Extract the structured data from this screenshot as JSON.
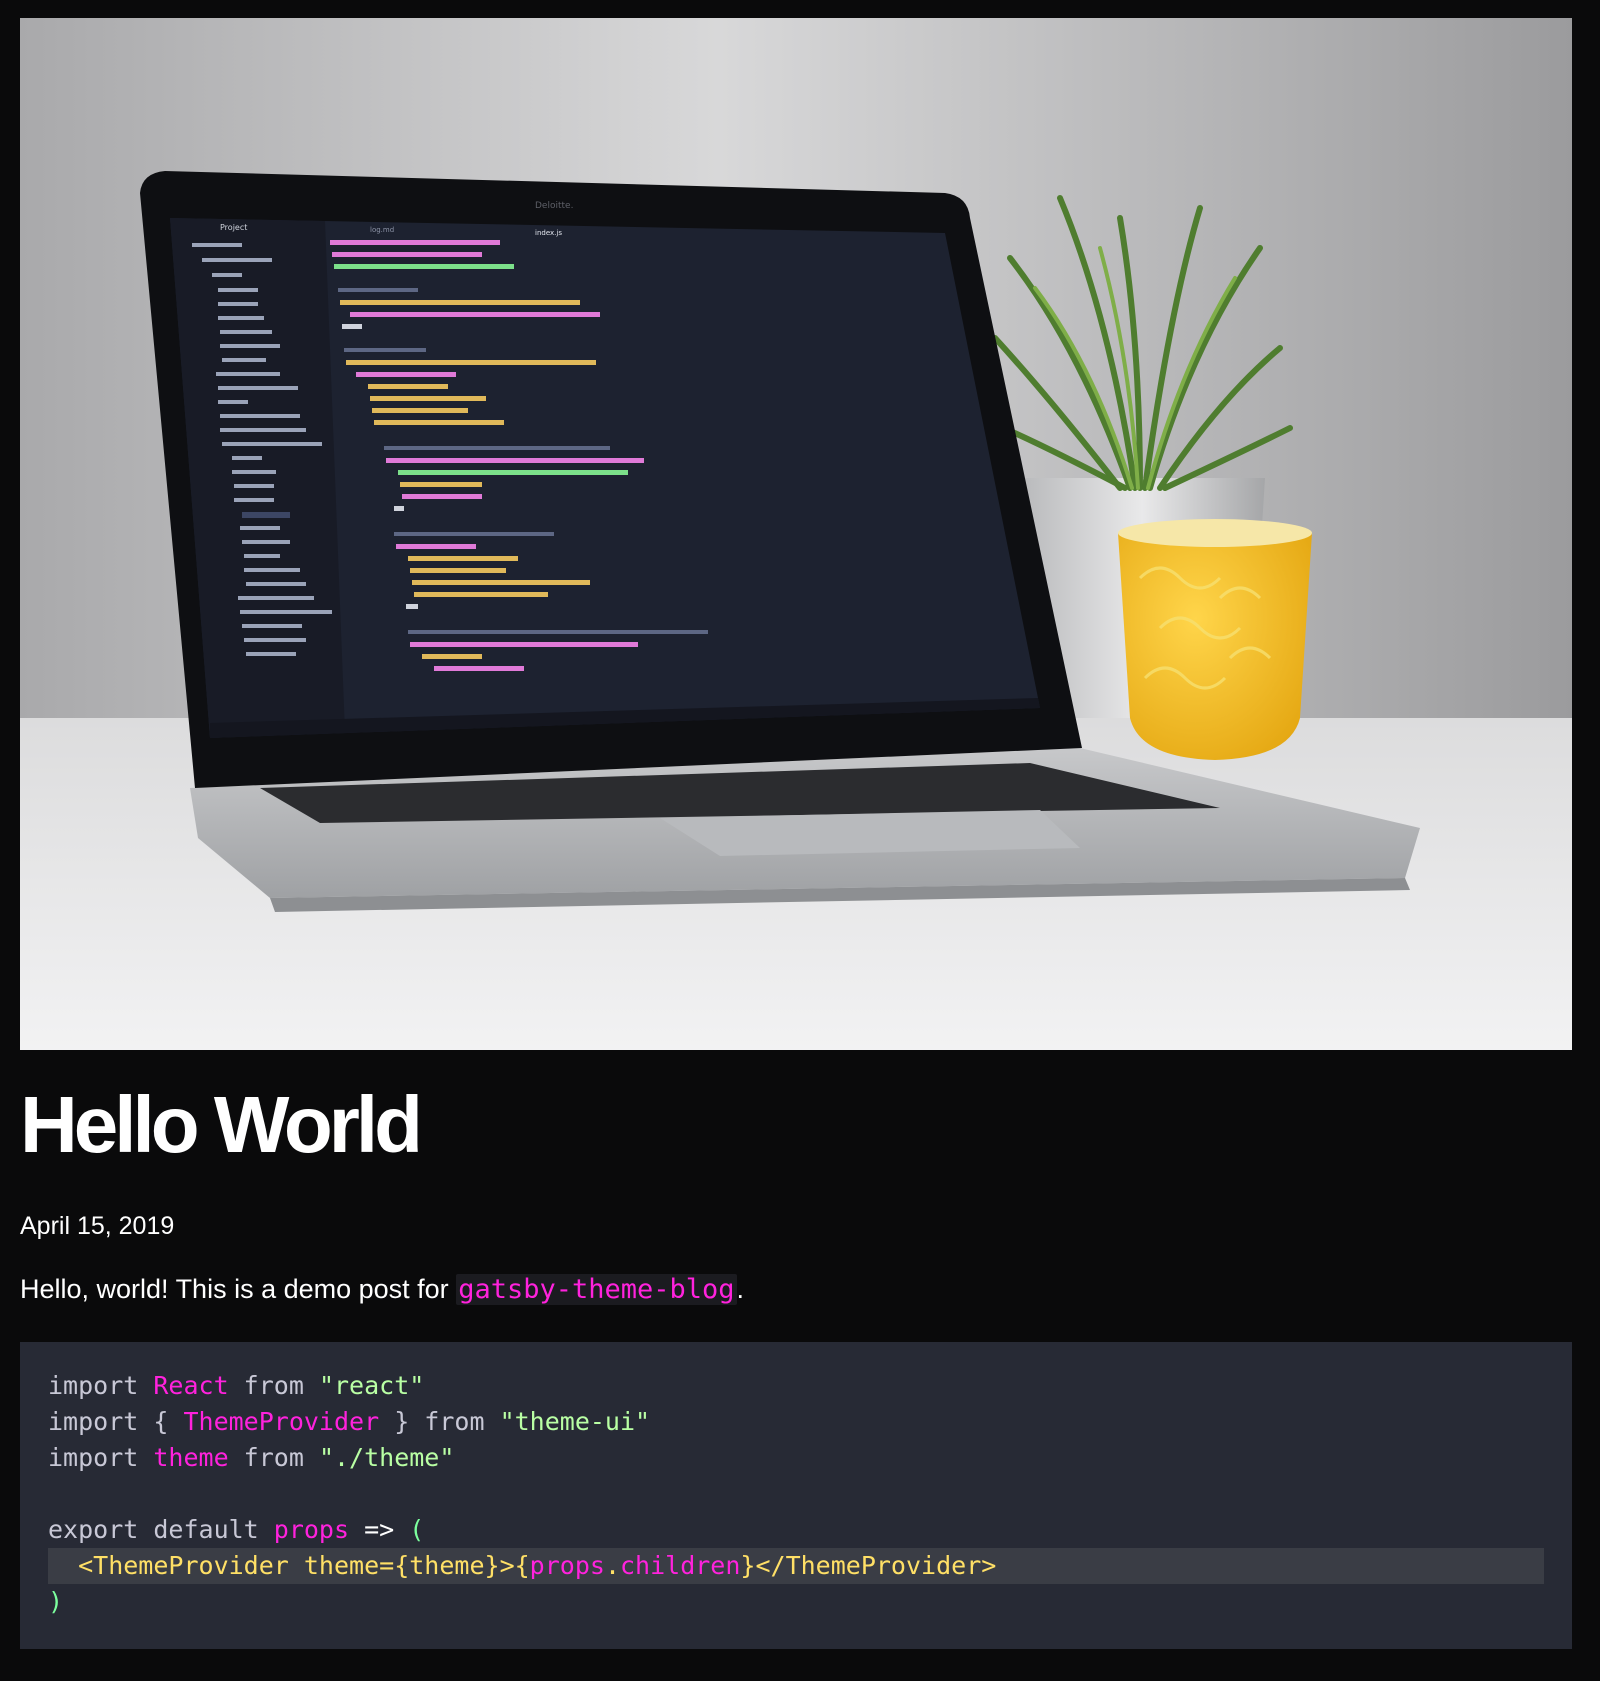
{
  "hero": {
    "alt_description": "",
    "screen_text": {
      "tab_left": "log.md",
      "tab_right": "index.js",
      "sidebar_title": "Project",
      "brand": "Deloitte."
    }
  },
  "post": {
    "title": "Hello World",
    "date": "April 15, 2019",
    "intro_before": "Hello, world! This is a demo post for ",
    "intro_code": "gatsby-theme-blog",
    "intro_after": "."
  },
  "code": {
    "lines": [
      [
        {
          "t": "import ",
          "c": "kw"
        },
        {
          "t": "React",
          "c": "id"
        },
        {
          "t": " from ",
          "c": "kw"
        },
        {
          "t": "\"react\"",
          "c": "str"
        }
      ],
      [
        {
          "t": "import ",
          "c": "kw"
        },
        {
          "t": "{ ",
          "c": "punc"
        },
        {
          "t": "ThemeProvider",
          "c": "id"
        },
        {
          "t": " } ",
          "c": "punc"
        },
        {
          "t": "from ",
          "c": "kw"
        },
        {
          "t": "\"theme-ui\"",
          "c": "str"
        }
      ],
      [
        {
          "t": "import ",
          "c": "kw"
        },
        {
          "t": "theme",
          "c": "id"
        },
        {
          "t": " from ",
          "c": "kw"
        },
        {
          "t": "\"./theme\"",
          "c": "str"
        }
      ],
      [],
      [
        {
          "t": "export default ",
          "c": "kw"
        },
        {
          "t": "props",
          "c": "id"
        },
        {
          "t": " => ",
          "c": "op"
        },
        {
          "t": "(",
          "c": "paren"
        }
      ],
      [
        {
          "t": "  <ThemeProvider ",
          "c": "tag"
        },
        {
          "t": "theme",
          "c": "attr"
        },
        {
          "t": "={",
          "c": "tag"
        },
        {
          "t": "theme",
          "c": "tag"
        },
        {
          "t": "}>{",
          "c": "tag"
        },
        {
          "t": "props",
          "c": "jsx"
        },
        {
          "t": ".",
          "c": "tag"
        },
        {
          "t": "children",
          "c": "jsx"
        },
        {
          "t": "}</ThemeProvider>",
          "c": "tag"
        }
      ],
      [
        {
          "t": ")",
          "c": "paren"
        }
      ]
    ],
    "highlighted_line_index": 5
  },
  "colors": {
    "page_bg": "#0a0a0b",
    "code_bg": "#272a35",
    "highlight_bg": "#3a3d45",
    "accent_magenta": "#ff22dd",
    "string_green": "#b9ffa4",
    "tag_yellow": "#ffe066"
  }
}
